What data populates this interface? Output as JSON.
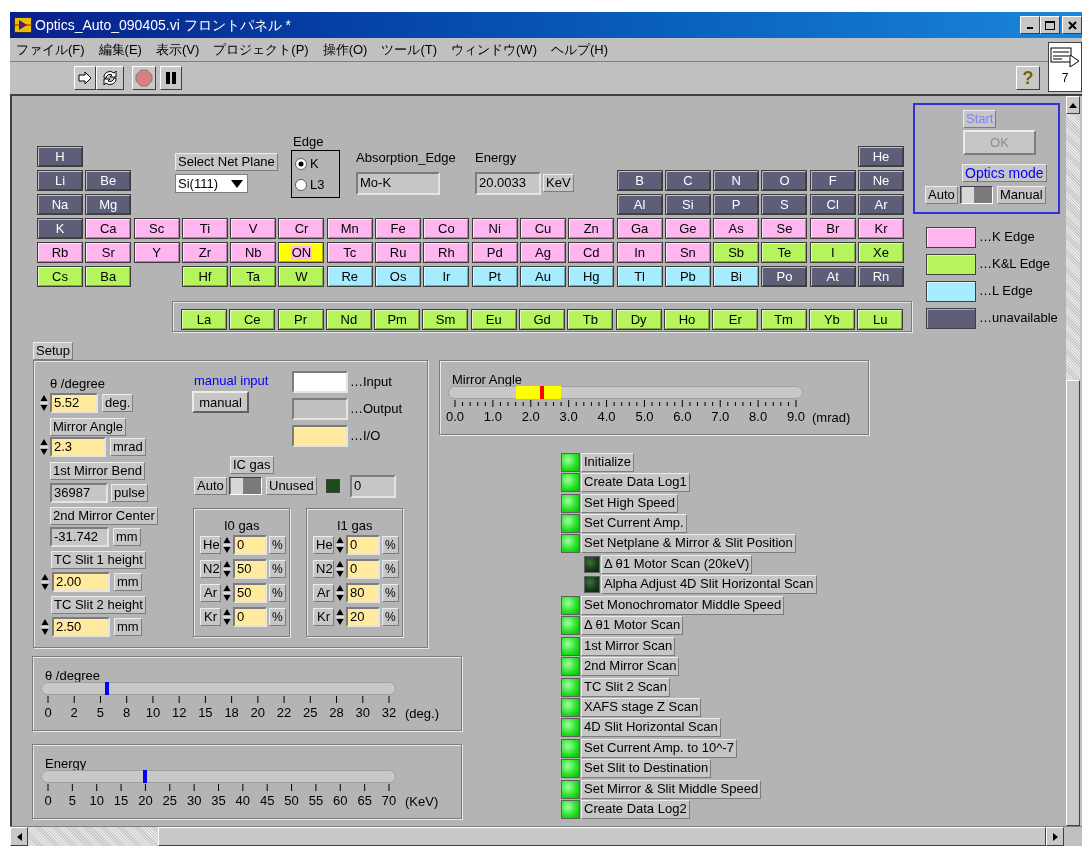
{
  "window": {
    "title": "Optics_Auto_090405.vi フロントパネル *"
  },
  "menu": [
    "ファイル(F)",
    "編集(E)",
    "表示(V)",
    "プロジェクト(P)",
    "操作(O)",
    "ツール(T)",
    "ウィンドウ(W)",
    "ヘルプ(H)"
  ],
  "toolbar": {
    "help": "?",
    "connector_label": "7",
    "abort_disabled": true
  },
  "periodic_table": {
    "rows": [
      [
        {
          "label": "H",
          "kind": "unavailable",
          "selected": false
        },
        null,
        null,
        null,
        null,
        null,
        null,
        null,
        null,
        null,
        null,
        null,
        null,
        null,
        null,
        null,
        null,
        {
          "label": "He",
          "kind": "unavailable",
          "selected": false
        }
      ],
      [
        {
          "label": "Li",
          "kind": "unavailable",
          "selected": false
        },
        {
          "label": "Be",
          "kind": "unavailable",
          "selected": false
        },
        null,
        null,
        null,
        null,
        null,
        null,
        null,
        null,
        null,
        null,
        {
          "label": "B",
          "kind": "unavailable",
          "selected": false
        },
        {
          "label": "C",
          "kind": "unavailable",
          "selected": false
        },
        {
          "label": "N",
          "kind": "unavailable",
          "selected": false
        },
        {
          "label": "O",
          "kind": "unavailable",
          "selected": false
        },
        {
          "label": "F",
          "kind": "unavailable",
          "selected": false
        },
        {
          "label": "Ne",
          "kind": "unavailable",
          "selected": false
        }
      ],
      [
        {
          "label": "Na",
          "kind": "unavailable",
          "selected": false
        },
        {
          "label": "Mg",
          "kind": "unavailable",
          "selected": false
        },
        null,
        null,
        null,
        null,
        null,
        null,
        null,
        null,
        null,
        null,
        {
          "label": "Al",
          "kind": "unavailable",
          "selected": false
        },
        {
          "label": "Si",
          "kind": "unavailable",
          "selected": false
        },
        {
          "label": "P",
          "kind": "unavailable",
          "selected": false
        },
        {
          "label": "S",
          "kind": "unavailable",
          "selected": false
        },
        {
          "label": "Cl",
          "kind": "unavailable",
          "selected": false
        },
        {
          "label": "Ar",
          "kind": "unavailable",
          "selected": false
        }
      ],
      [
        {
          "label": "K",
          "kind": "unavailable",
          "selected": false
        },
        {
          "label": "Ca",
          "kind": "k_edge",
          "selected": false
        },
        {
          "label": "Sc",
          "kind": "k_edge",
          "selected": false
        },
        {
          "label": "Ti",
          "kind": "k_edge",
          "selected": false
        },
        {
          "label": "V",
          "kind": "k_edge",
          "selected": false
        },
        {
          "label": "Cr",
          "kind": "k_edge",
          "selected": false
        },
        {
          "label": "Mn",
          "kind": "k_edge",
          "selected": false
        },
        {
          "label": "Fe",
          "kind": "k_edge",
          "selected": false
        },
        {
          "label": "Co",
          "kind": "k_edge",
          "selected": false
        },
        {
          "label": "Ni",
          "kind": "k_edge",
          "selected": false
        },
        {
          "label": "Cu",
          "kind": "k_edge",
          "selected": false
        },
        {
          "label": "Zn",
          "kind": "k_edge",
          "selected": false
        },
        {
          "label": "Ga",
          "kind": "k_edge",
          "selected": false
        },
        {
          "label": "Ge",
          "kind": "k_edge",
          "selected": false
        },
        {
          "label": "As",
          "kind": "k_edge",
          "selected": false
        },
        {
          "label": "Se",
          "kind": "k_edge",
          "selected": false
        },
        {
          "label": "Br",
          "kind": "k_edge",
          "selected": false
        },
        {
          "label": "Kr",
          "kind": "k_edge",
          "selected": false
        }
      ],
      [
        {
          "label": "Rb",
          "kind": "k_edge",
          "selected": false
        },
        {
          "label": "Sr",
          "kind": "k_edge",
          "selected": false
        },
        {
          "label": "Y",
          "kind": "k_edge",
          "selected": false
        },
        {
          "label": "Zr",
          "kind": "k_edge",
          "selected": false
        },
        {
          "label": "Nb",
          "kind": "k_edge",
          "selected": false
        },
        {
          "label": "ON",
          "kind": "k_edge",
          "selected": true
        },
        {
          "label": "Tc",
          "kind": "k_edge",
          "selected": false
        },
        {
          "label": "Ru",
          "kind": "k_edge",
          "selected": false
        },
        {
          "label": "Rh",
          "kind": "k_edge",
          "selected": false
        },
        {
          "label": "Pd",
          "kind": "k_edge",
          "selected": false
        },
        {
          "label": "Ag",
          "kind": "k_edge",
          "selected": false
        },
        {
          "label": "Cd",
          "kind": "k_edge",
          "selected": false
        },
        {
          "label": "In",
          "kind": "k_edge",
          "selected": false
        },
        {
          "label": "Sn",
          "kind": "k_edge",
          "selected": false
        },
        {
          "label": "Sb",
          "kind": "kl_edge",
          "selected": false
        },
        {
          "label": "Te",
          "kind": "kl_edge",
          "selected": false
        },
        {
          "label": "I",
          "kind": "kl_edge",
          "selected": false
        },
        {
          "label": "Xe",
          "kind": "kl_edge",
          "selected": false
        }
      ],
      [
        {
          "label": "Cs",
          "kind": "kl_edge",
          "selected": false
        },
        {
          "label": "Ba",
          "kind": "kl_edge",
          "selected": false
        },
        null,
        {
          "label": "Hf",
          "kind": "kl_edge",
          "selected": false
        },
        {
          "label": "Ta",
          "kind": "kl_edge",
          "selected": false
        },
        {
          "label": "W",
          "kind": "kl_edge",
          "selected": false
        },
        {
          "label": "Re",
          "kind": "l_edge",
          "selected": false
        },
        {
          "label": "Os",
          "kind": "l_edge",
          "selected": false
        },
        {
          "label": "Ir",
          "kind": "l_edge",
          "selected": false
        },
        {
          "label": "Pt",
          "kind": "l_edge",
          "selected": false
        },
        {
          "label": "Au",
          "kind": "l_edge",
          "selected": false
        },
        {
          "label": "Hg",
          "kind": "l_edge",
          "selected": false
        },
        {
          "label": "Tl",
          "kind": "l_edge",
          "selected": false
        },
        {
          "label": "Pb",
          "kind": "l_edge",
          "selected": false
        },
        {
          "label": "Bi",
          "kind": "l_edge",
          "selected": false
        },
        {
          "label": "Po",
          "kind": "unavailable",
          "selected": false
        },
        {
          "label": "At",
          "kind": "unavailable",
          "selected": false
        },
        {
          "label": "Rn",
          "kind": "unavailable",
          "selected": false
        }
      ]
    ],
    "lanthanides": [
      {
        "label": "La",
        "kind": "kl_edge",
        "selected": false
      },
      {
        "label": "Ce",
        "kind": "kl_edge",
        "selected": false
      },
      {
        "label": "Pr",
        "kind": "kl_edge",
        "selected": false
      },
      {
        "label": "Nd",
        "kind": "kl_edge",
        "selected": false
      },
      {
        "label": "Pm",
        "kind": "kl_edge",
        "selected": false
      },
      {
        "label": "Sm",
        "kind": "kl_edge",
        "selected": false
      },
      {
        "label": "Eu",
        "kind": "kl_edge",
        "selected": false
      },
      {
        "label": "Gd",
        "kind": "kl_edge",
        "selected": false
      },
      {
        "label": "Tb",
        "kind": "kl_edge",
        "selected": false
      },
      {
        "label": "Dy",
        "kind": "kl_edge",
        "selected": false
      },
      {
        "label": "Ho",
        "kind": "kl_edge",
        "selected": false
      },
      {
        "label": "Er",
        "kind": "kl_edge",
        "selected": false
      },
      {
        "label": "Tm",
        "kind": "kl_edge",
        "selected": false
      },
      {
        "label": "Yb",
        "kind": "kl_edge",
        "selected": false
      },
      {
        "label": "Lu",
        "kind": "kl_edge",
        "selected": false
      }
    ]
  },
  "net_plane": {
    "label": "Select Net Plane",
    "value": "Si(111)"
  },
  "edge": {
    "label": "Edge",
    "options": [
      {
        "label": "K",
        "selected": true
      },
      {
        "label": "L3",
        "selected": false
      }
    ]
  },
  "absorption_edge": {
    "label": "Absorption_Edge",
    "value": "Mo-K"
  },
  "energy": {
    "label": "Energy",
    "value": "20.0033",
    "unit": "KeV"
  },
  "start_panel": {
    "start_label": "Start",
    "ok": {
      "label": "OK",
      "disabled": true
    },
    "mode_label": "Optics mode",
    "switch": {
      "left": "Auto",
      "right": "Manual",
      "manual": false
    }
  },
  "legend": [
    {
      "label": "…K Edge",
      "kind": "k_edge"
    },
    {
      "label": "…K&L Edge",
      "kind": "kl_edge"
    },
    {
      "label": "…L Edge",
      "kind": "l_edge"
    },
    {
      "label": "…unavailable",
      "kind": "unavailable"
    }
  ],
  "setup": {
    "tab": "Setup",
    "fields": [
      {
        "label": "θ /degree",
        "value": "5.52",
        "unit": "deg.",
        "kind": "control"
      },
      {
        "label": "Mirror Angle",
        "value": "2.3",
        "unit": "mrad",
        "kind": "control"
      },
      {
        "label": "1st Mirror Bend",
        "value": "36987",
        "unit": "pulse",
        "kind": "indicator"
      },
      {
        "label": "2nd Mirror Center",
        "value": "-31.742",
        "unit": "mm",
        "kind": "indicator"
      },
      {
        "label": "TC Slit 1 height",
        "value": "2.00",
        "unit": "mm",
        "kind": "control"
      },
      {
        "label": "TC Slit 2 height",
        "value": "2.50",
        "unit": "mm",
        "kind": "control"
      }
    ],
    "manual_input": {
      "label": "manual input",
      "button": "manual"
    },
    "io_legend": [
      {
        "label": "…Input",
        "kind": "input"
      },
      {
        "label": "…Output",
        "kind": "output"
      },
      {
        "label": "…I/O",
        "kind": "io"
      }
    ],
    "ic_gas": {
      "label": "IC gas",
      "left": "Auto",
      "right": "Unused",
      "unused": false,
      "led_on": false,
      "value": "0"
    },
    "gas_groups": [
      {
        "title": "I0 gas",
        "rows": [
          {
            "gas": "He",
            "value": "0",
            "unit": "%"
          },
          {
            "gas": "N2",
            "value": "50",
            "unit": "%"
          },
          {
            "gas": "Ar",
            "value": "50",
            "unit": "%"
          },
          {
            "gas": "Kr",
            "value": "0",
            "unit": "%"
          }
        ]
      },
      {
        "title": "I1 gas",
        "rows": [
          {
            "gas": "He",
            "value": "0",
            "unit": "%"
          },
          {
            "gas": "N2",
            "value": "0",
            "unit": "%"
          },
          {
            "gas": "Ar",
            "value": "80",
            "unit": "%"
          },
          {
            "gas": "Kr",
            "value": "20",
            "unit": "%"
          }
        ]
      }
    ]
  },
  "mirror_angle_slider": {
    "label": "Mirror Angle",
    "level": 0.2556,
    "ticks": [
      "0.0",
      "1.0",
      "2.0",
      "3.0",
      "4.0",
      "5.0",
      "6.0",
      "7.0",
      "8.0",
      "9.0"
    ],
    "unit": "(mrad)"
  },
  "sliders": [
    {
      "label": "θ /degree",
      "level": 0.1725,
      "ticks": [
        "0",
        "2",
        "5",
        "8",
        "10",
        "12",
        "15",
        "18",
        "20",
        "22",
        "25",
        "28",
        "30",
        "32"
      ],
      "unit": "(deg.)"
    },
    {
      "label": "Energy",
      "level": 0.2858,
      "ticks": [
        "0",
        "5",
        "10",
        "15",
        "20",
        "25",
        "30",
        "35",
        "40",
        "45",
        "50",
        "55",
        "60",
        "65",
        "70"
      ],
      "unit": "(KeV)"
    }
  ],
  "steps": [
    {
      "label": "Initialize",
      "on": true
    },
    {
      "label": "Create Data Log1",
      "on": true
    },
    {
      "label": "Set High Speed",
      "on": true
    },
    {
      "label": "Set Current Amp.",
      "on": true
    },
    {
      "label": "Set Netplane & Mirror & Slit Position",
      "on": true,
      "children": [
        {
          "label": "Δ θ1 Motor Scan (20keV)",
          "on": false
        },
        {
          "label": "Alpha Adjust 4D Slit Horizontal Scan",
          "on": false
        }
      ]
    },
    {
      "label": "Set Monochromator Middle Speed",
      "on": true
    },
    {
      "label": "Δ θ1 Motor Scan",
      "on": true
    },
    {
      "label": "1st Mirror Scan",
      "on": true
    },
    {
      "label": "2nd Mirror Scan",
      "on": true
    },
    {
      "label": "TC Slit 2 Scan",
      "on": true
    },
    {
      "label": "XAFS stage Z Scan",
      "on": true
    },
    {
      "label": "4D Slit Horizontal Scan",
      "on": true
    },
    {
      "label": "Set Current Amp. to 10^-7",
      "on": true
    },
    {
      "label": "Set Slit to Destination",
      "on": true
    },
    {
      "label": "Set Mirror & Slit Middle Speed",
      "on": true
    },
    {
      "label": "Create Data Log2",
      "on": true
    }
  ]
}
